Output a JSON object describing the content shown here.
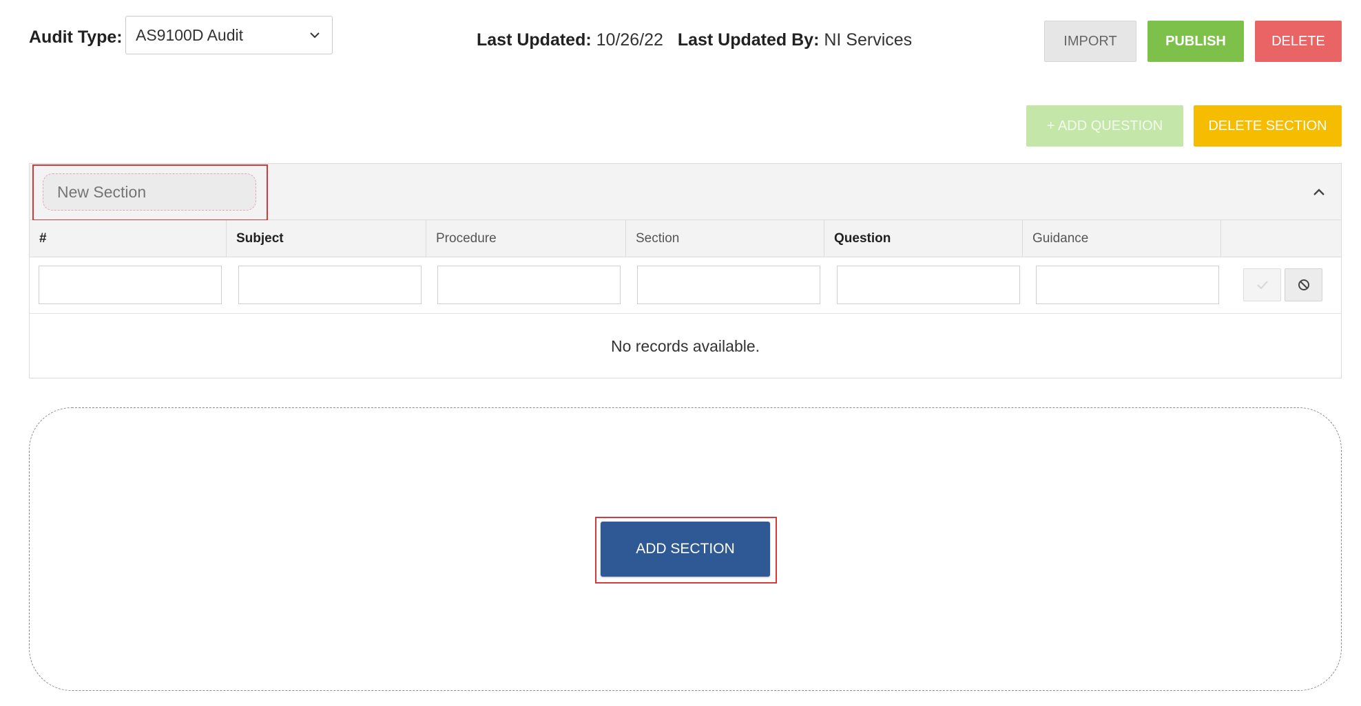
{
  "header": {
    "audit_type_label": "Audit Type:",
    "audit_type_value": "AS9100D Audit",
    "last_updated_label": "Last Updated:",
    "last_updated_value": "10/26/22",
    "last_updated_by_label": "Last Updated By:",
    "last_updated_by_value": "NI Services"
  },
  "actions": {
    "import": "IMPORT",
    "publish": "PUBLISH",
    "delete": "DELETE",
    "add_question": "+ ADD QUESTION",
    "delete_section": "DELETE SECTION",
    "add_section": "ADD SECTION"
  },
  "section": {
    "name_value": "",
    "name_placeholder": "New Section",
    "columns": [
      {
        "label": "#",
        "bold": true
      },
      {
        "label": "Subject",
        "bold": true
      },
      {
        "label": "Procedure",
        "bold": false
      },
      {
        "label": "Section",
        "bold": false
      },
      {
        "label": "Question",
        "bold": true
      },
      {
        "label": "Guidance",
        "bold": false
      }
    ],
    "empty_message": "No records available."
  },
  "icons": {
    "dropdown": "chevron-down-icon",
    "collapse": "chevron-up-icon",
    "save_row": "check-icon",
    "cancel_row": "cancel-icon"
  },
  "colors": {
    "publish": "#7dc14b",
    "delete": "#e96565",
    "delete_section": "#f6bd00",
    "add_question_disabled": "#c5e6a9",
    "add_section": "#2e5995",
    "highlight": "#d43a3a"
  }
}
